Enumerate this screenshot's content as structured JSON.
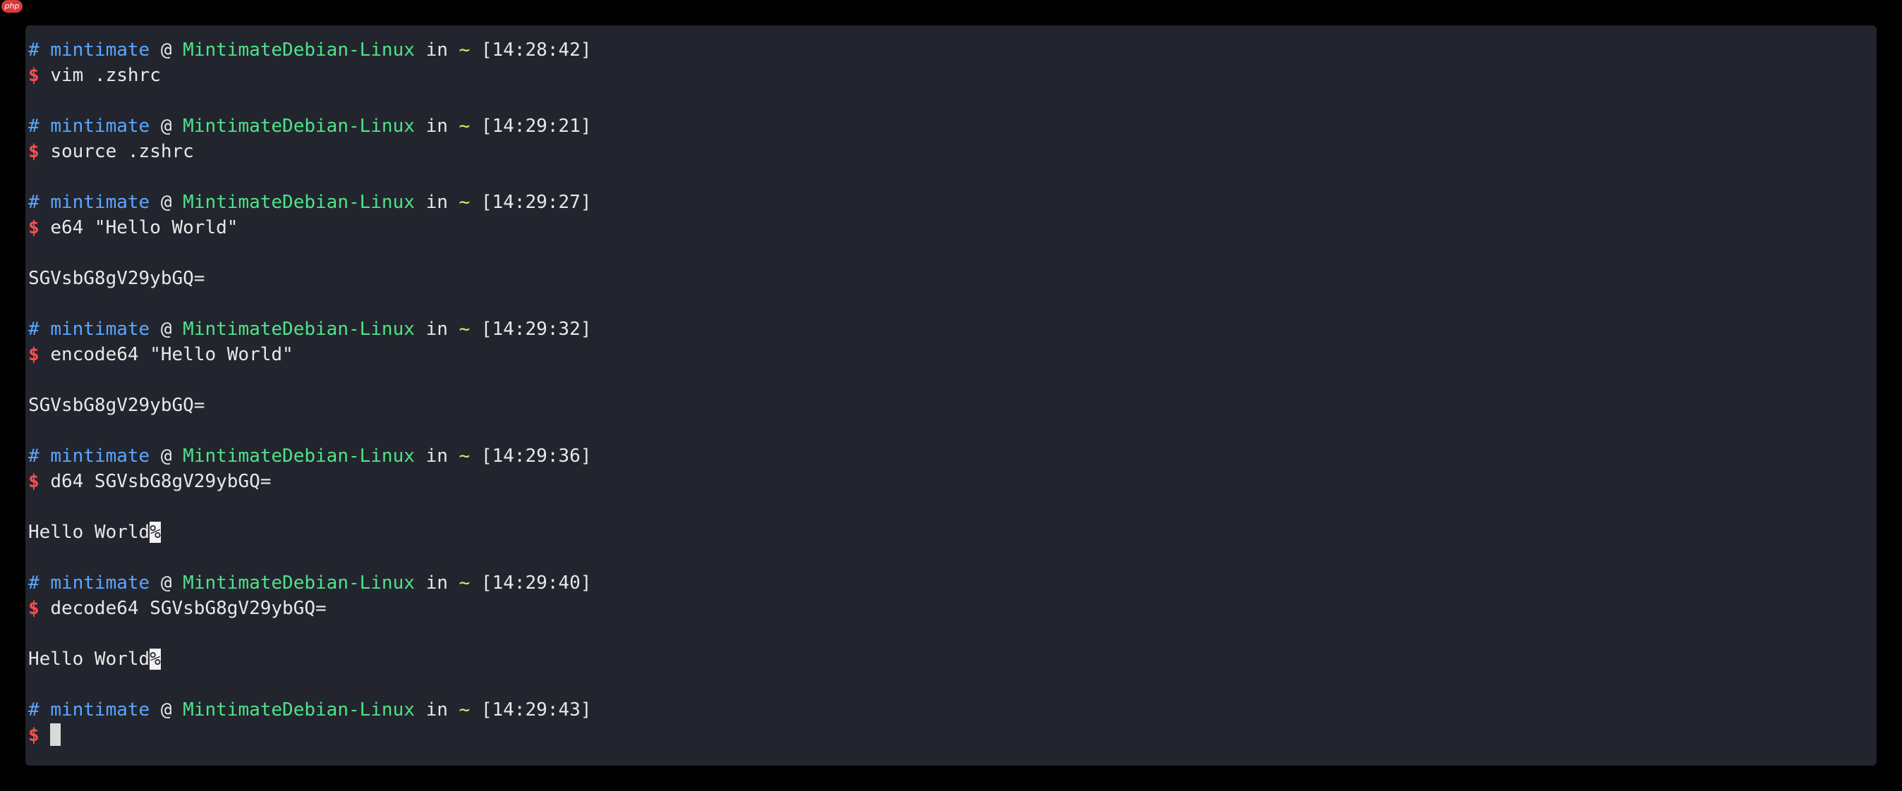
{
  "watermark": "php",
  "colors": {
    "background": "#23252e",
    "prompt_user": "#5aa7ff",
    "prompt_host": "#4ee387",
    "prompt_dir": "#e7e76a",
    "dollar": "#ff4d4d",
    "text": "#e8e8e8"
  },
  "prompt": {
    "hash": "#",
    "user": "mintimate",
    "at": "@",
    "host": "MintimateDebian-Linux",
    "in": "in",
    "dir": "~",
    "dollar": "$"
  },
  "blocks": [
    {
      "time": "[14:28:42]",
      "command": "vim .zshrc"
    },
    {
      "time": "[14:29:21]",
      "command": "source .zshrc"
    },
    {
      "time": "[14:29:27]",
      "command": "e64 \"Hello World\"",
      "output": "SGVsbG8gV29ybGQ="
    },
    {
      "time": "[14:29:32]",
      "command": "encode64 \"Hello World\"",
      "output": "SGVsbG8gV29ybGQ="
    },
    {
      "time": "[14:29:36]",
      "command": "d64 SGVsbG8gV29ybGQ=",
      "output": "Hello World",
      "output_marker": "%"
    },
    {
      "time": "[14:29:40]",
      "command": "decode64 SGVsbG8gV29ybGQ=",
      "output": "Hello World",
      "output_marker": "%"
    },
    {
      "time": "[14:29:43]",
      "command": ""
    }
  ]
}
